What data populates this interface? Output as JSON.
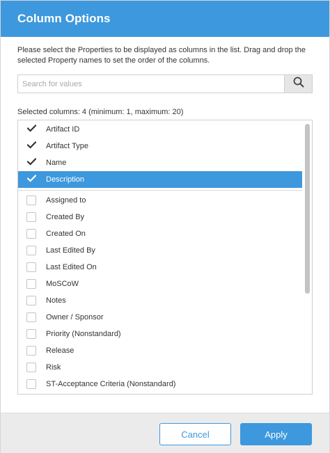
{
  "dialog": {
    "title": "Column Options",
    "description": "Please select the Properties to be displayed as columns in the list. Drag and drop the selected Property names to set the order of the columns.",
    "search_placeholder": "Search for values",
    "selected_info": "Selected columns: 4 (minimum: 1, maximum: 20)",
    "selected_items": [
      {
        "label": "Artifact ID",
        "checked": true
      },
      {
        "label": "Artifact Type",
        "checked": true
      },
      {
        "label": "Name",
        "checked": true
      },
      {
        "label": "Description",
        "checked": true,
        "highlighted": true
      }
    ],
    "unselected_items": [
      {
        "label": "Assigned to",
        "checked": false
      },
      {
        "label": "Created By",
        "checked": false
      },
      {
        "label": "Created On",
        "checked": false
      },
      {
        "label": "Last Edited By",
        "checked": false
      },
      {
        "label": "Last Edited On",
        "checked": false
      },
      {
        "label": "MoSCoW",
        "checked": false
      },
      {
        "label": "Notes",
        "checked": false
      },
      {
        "label": "Owner / Sponsor",
        "checked": false
      },
      {
        "label": "Priority (Nonstandard)",
        "checked": false
      },
      {
        "label": "Release",
        "checked": false
      },
      {
        "label": "Risk",
        "checked": false
      },
      {
        "label": "ST-Acceptance Criteria (Nonstandard)",
        "checked": false
      },
      {
        "label": "",
        "checked": false
      }
    ],
    "cancel_label": "Cancel",
    "apply_label": "Apply"
  },
  "icons": {
    "search": "search-icon",
    "check": "checkmark-icon"
  },
  "colors": {
    "accent": "#3d98dd",
    "footer_bg": "#ebebeb",
    "highlight_text": "#ffffff"
  }
}
